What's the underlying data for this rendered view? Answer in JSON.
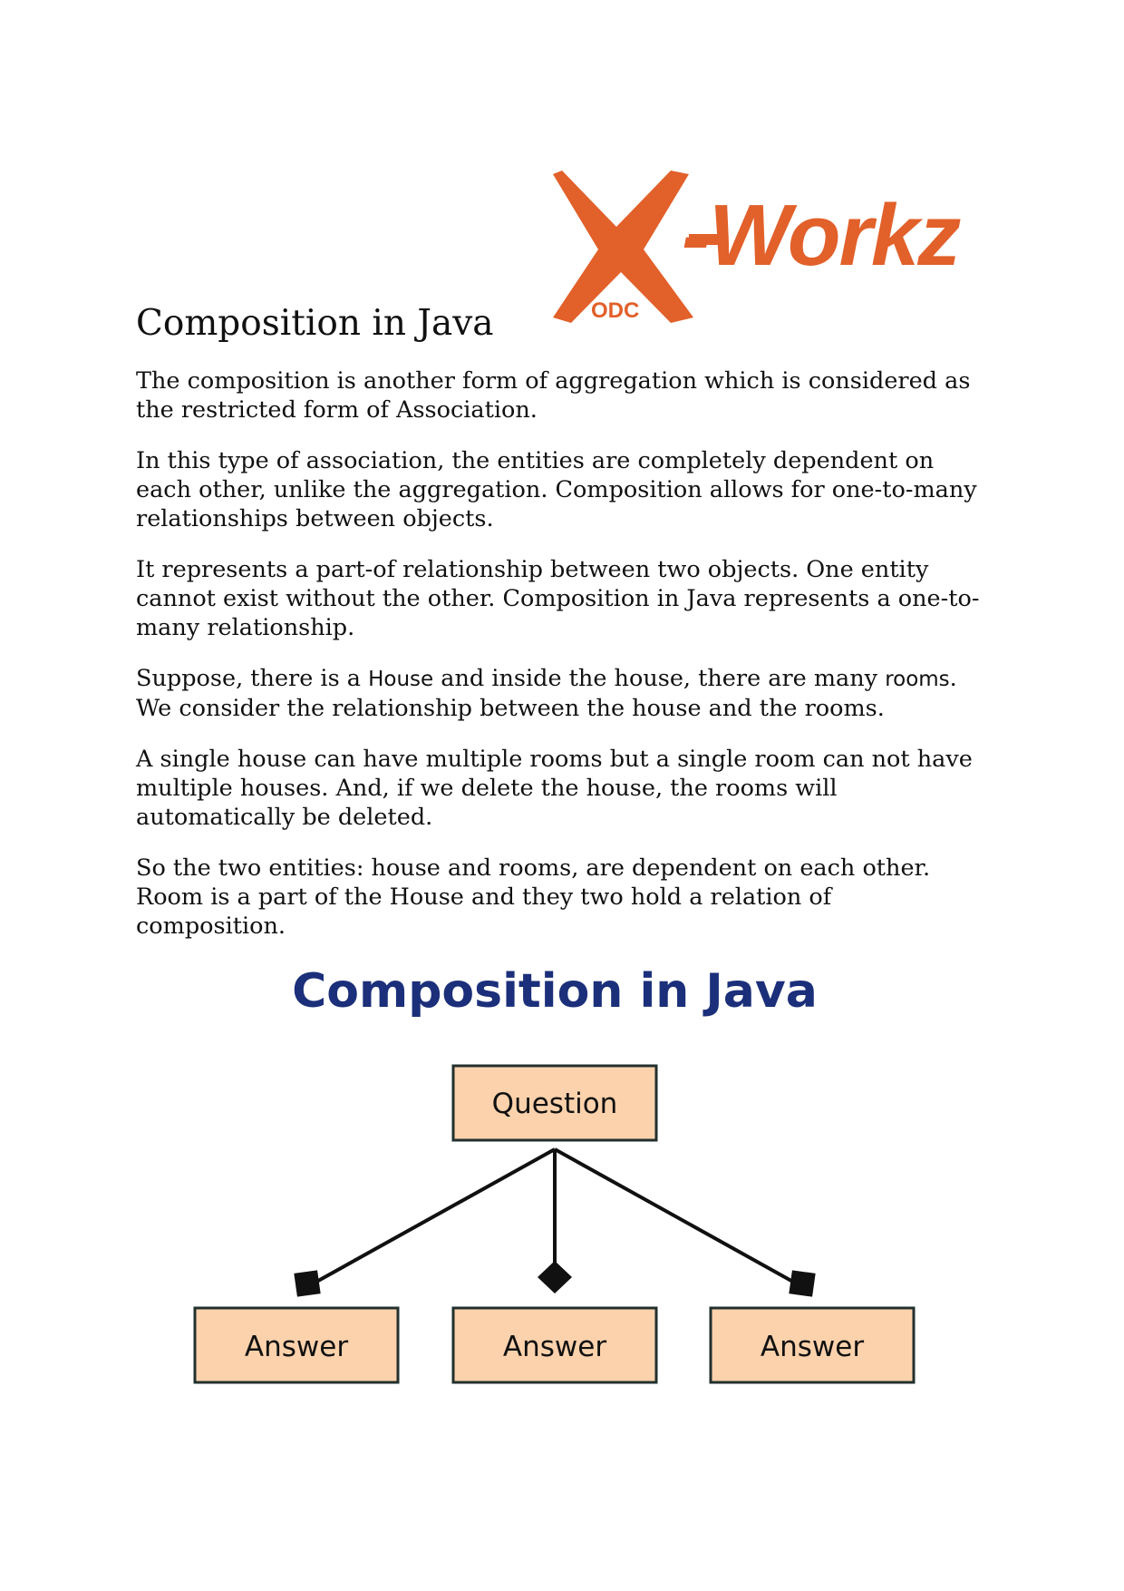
{
  "logo": {
    "text": "-Workz",
    "subtext": "ODC",
    "color": "#e2602a"
  },
  "heading": "Composition in Java",
  "paragraphs": {
    "p1": "The composition is another form of aggregation which is considered as the restricted form of Association.",
    "p2": "In this type of association, the entities are completely dependent on each other, unlike the aggregation. Composition allows for one-to-many relationships between objects.",
    "p3": "It represents a part-of relationship between two objects. One entity cannot exist without the other. Composition in Java represents a one-to-many relationship.",
    "p4": {
      "a": "Suppose, there is a ",
      "b": "House",
      "c": " and inside the house, there are many ",
      "d": "rooms",
      "e": ". We consider the relationship between the house and the rooms."
    },
    "p5": "A single house can have multiple rooms but a single room can not have multiple houses. And, if we delete the house, the rooms will automatically be deleted.",
    "p6": "So the two entities: house and rooms, are dependent on each other. Room is a part of the House and they two hold a relation of composition."
  },
  "diagram": {
    "title": "Composition in Java",
    "root": "Question",
    "children": [
      "Answer",
      "Answer",
      "Answer"
    ],
    "colors": {
      "title": "#1b2f7a",
      "box_fill": "#fcd2ac",
      "box_stroke": "#22302e",
      "line": "#111111"
    }
  }
}
